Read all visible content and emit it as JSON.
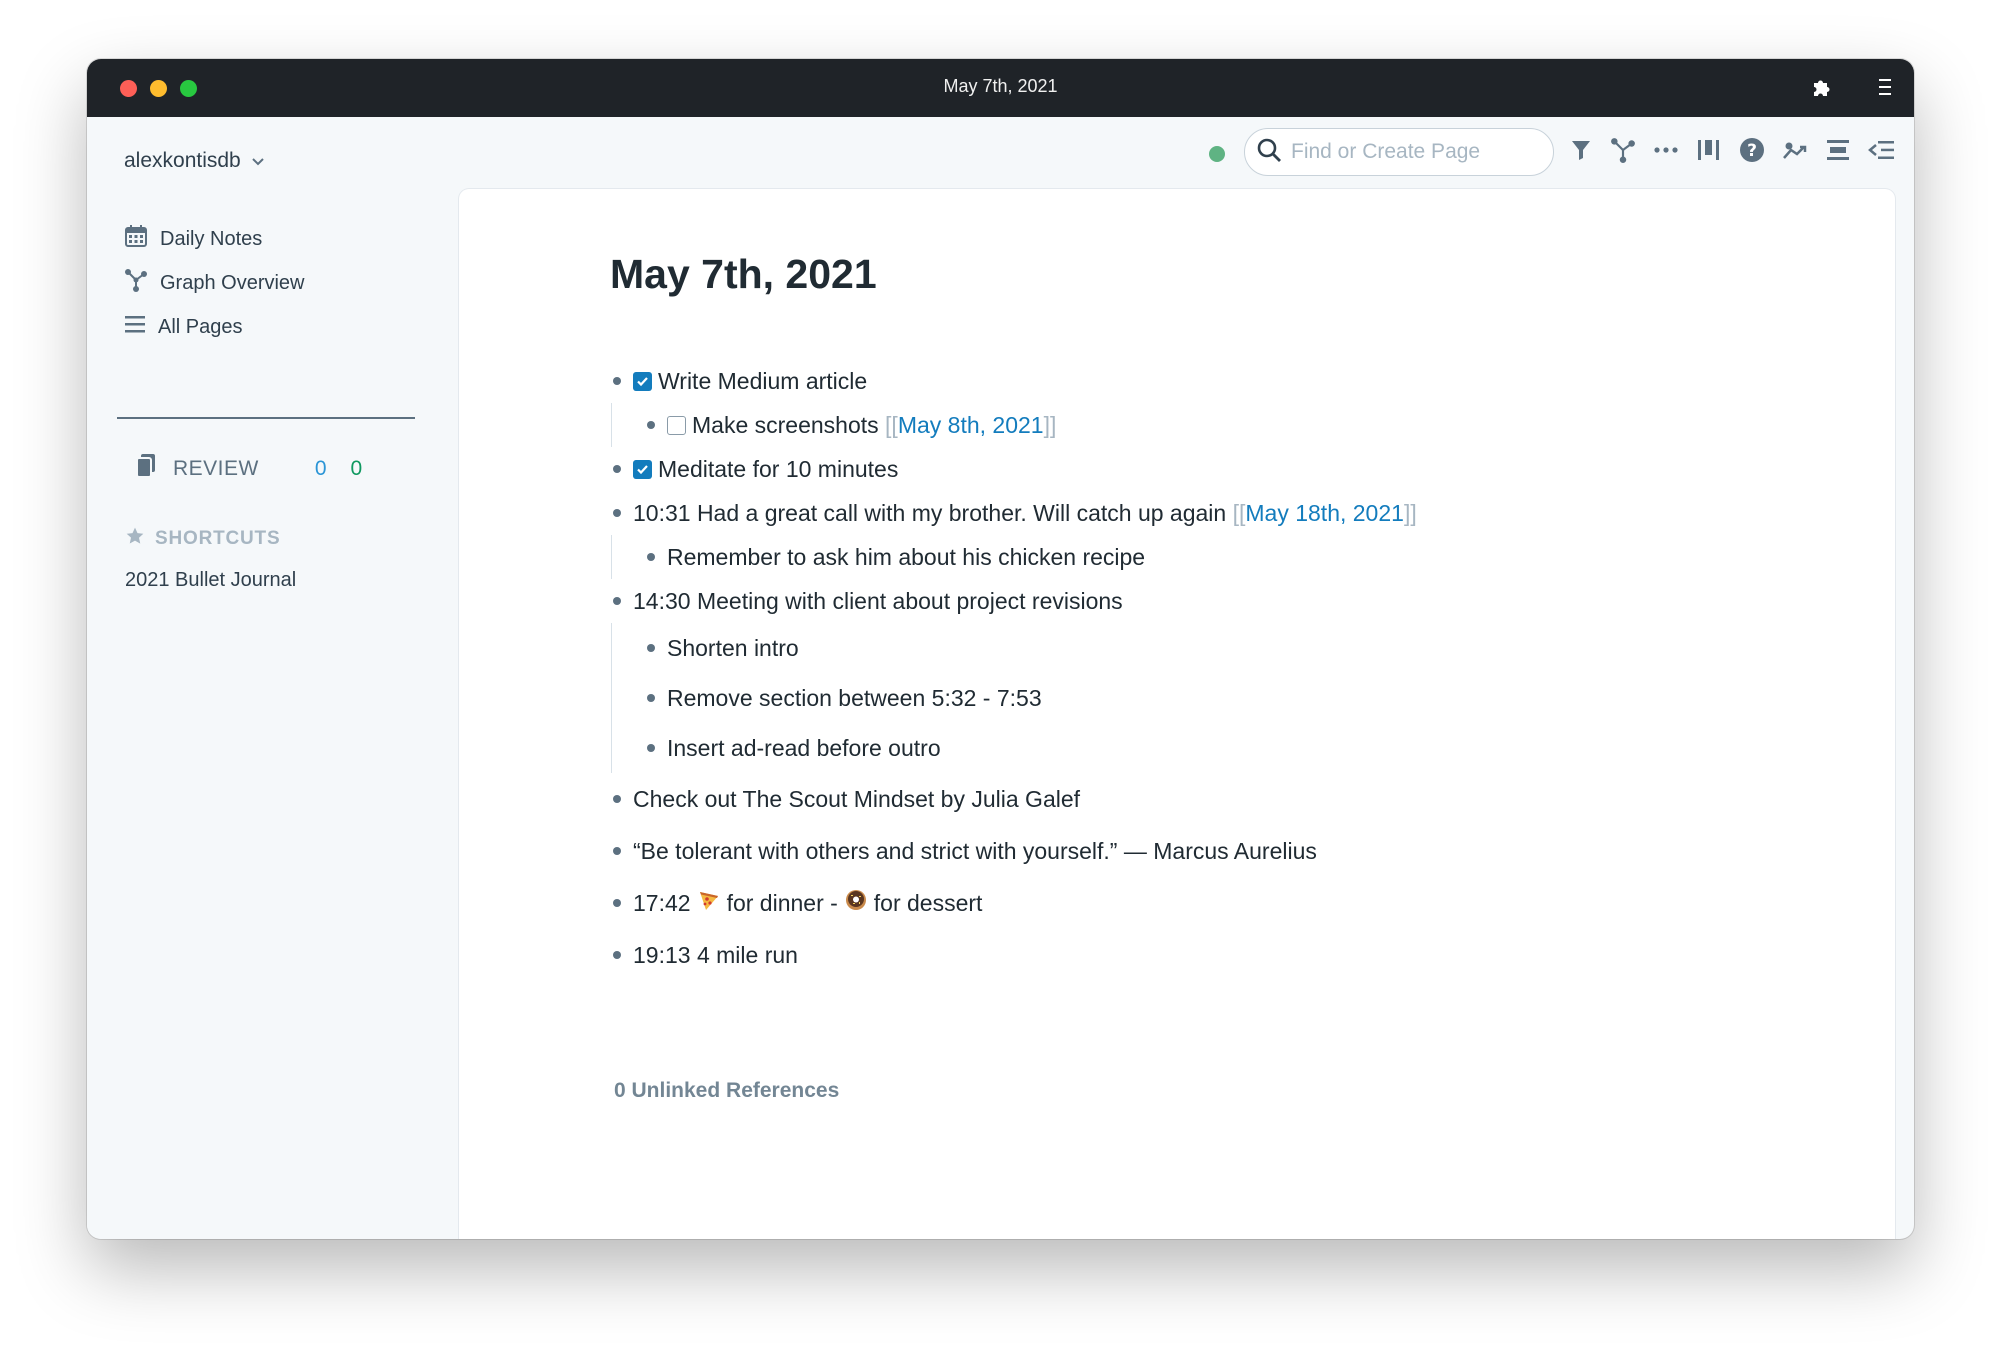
{
  "window": {
    "title": "May 7th, 2021"
  },
  "sidebar": {
    "db_name": "alexkontisdb",
    "nav": [
      {
        "label": "Daily Notes",
        "icon": "calendar-icon"
      },
      {
        "label": "Graph Overview",
        "icon": "graph-icon"
      },
      {
        "label": "All Pages",
        "icon": "list-icon"
      }
    ],
    "review": {
      "label": "REVIEW",
      "count_blue": "0",
      "count_green": "0"
    },
    "shortcuts": {
      "heading": "SHORTCUTS",
      "items": [
        "2021 Bullet Journal"
      ]
    }
  },
  "toolbar": {
    "search_placeholder": "Find or Create Page",
    "icons": [
      "filter-icon",
      "graph-icon",
      "more-icon",
      "columns-icon",
      "help-icon",
      "slack-icon",
      "align-icon",
      "sidebar-toggle-icon"
    ]
  },
  "page": {
    "title": "May 7th, 2021",
    "blocks": [
      {
        "text": "Write Medium article",
        "checked": true
      },
      {
        "text": "Make screenshots ",
        "checked": false,
        "ref": "May 8th, 2021"
      },
      {
        "text": "Meditate for 10 minutes",
        "checked": true
      },
      {
        "text": "10:31 Had a great call with my brother. Will catch up again ",
        "ref": "May 18th, 2021"
      },
      {
        "text": "Remember to ask him about his chicken recipe"
      },
      {
        "text": "14:30 Meeting with client about project revisions"
      },
      {
        "text": "Shorten intro"
      },
      {
        "text": "Remove section between 5:32 - 7:53"
      },
      {
        "text": "Insert ad-read before outro"
      },
      {
        "text": "Check out The Scout Mindset by Julia Galef"
      },
      {
        "text": "“Be tolerant with others and strict with yourself.” — Marcus Aurelius"
      },
      {
        "text_a": "17:42",
        "emoji_a": "pizza-emoji",
        "text_b": "for dinner -",
        "emoji_b": "donut-emoji",
        "text_c": "for dessert"
      },
      {
        "text": "19:13 4 mile run"
      }
    ],
    "bracket_open": "[[",
    "bracket_close": "]]",
    "unlinked_references": "0 Unlinked References"
  },
  "colors": {
    "accent": "#137cbd",
    "sync": "#5fb383",
    "titlebar": "#1f2328"
  }
}
